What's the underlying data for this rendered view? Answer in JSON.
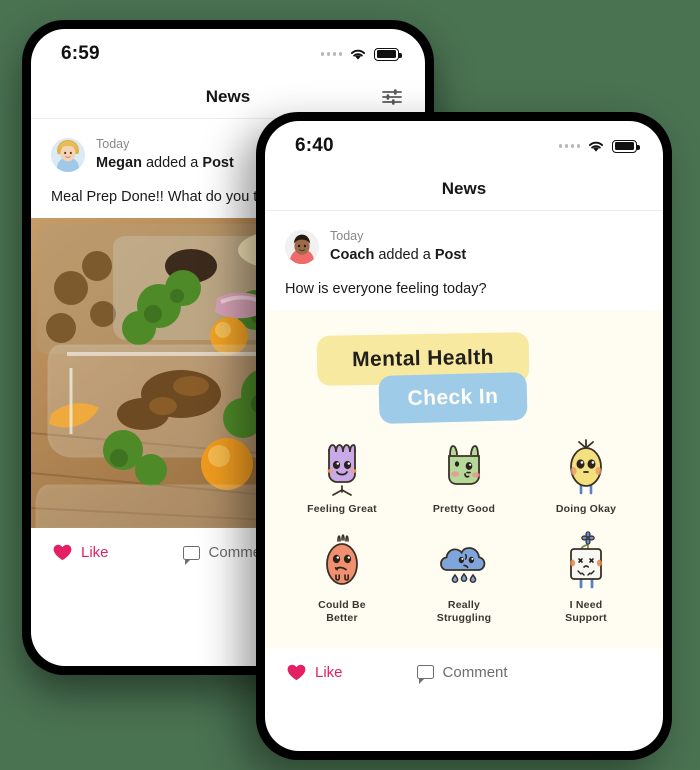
{
  "theme": {
    "page_background": "#4a7352",
    "accent_like": "#e51f63",
    "checkin_background": "#fffcf2",
    "banner_yellow": "#f8e9a1",
    "banner_blue": "#9ecbe8"
  },
  "phone_back": {
    "status": {
      "time": "6:59",
      "signal_icon": "signal-dots-icon",
      "wifi_icon": "wifi-icon",
      "battery_icon": "battery-full-icon"
    },
    "nav": {
      "title": "News",
      "filter_icon": "filter-sliders-icon"
    },
    "post": {
      "avatar_icon": "avatar-megan",
      "when": "Today",
      "author": "Megan",
      "action_middle": " added a ",
      "action_type": "Post",
      "body": "Meal Prep Done!! What do you thi",
      "image_icon": "meal-prep-photo"
    },
    "actions": {
      "like_label": "Like",
      "like_icon": "heart-icon",
      "comment_label": "Comment",
      "comment_icon": "comment-bubble-icon"
    }
  },
  "phone_front": {
    "status": {
      "time": "6:40",
      "signal_icon": "signal-dots-icon",
      "wifi_icon": "wifi-icon",
      "battery_icon": "battery-full-icon"
    },
    "nav": {
      "title": "News"
    },
    "post": {
      "avatar_icon": "avatar-coach",
      "when": "Today",
      "author": "Coach",
      "action_middle": " added a ",
      "action_type": "Post",
      "body": "How is everyone feeling today?"
    },
    "checkin": {
      "banner_top": "Mental Health",
      "banner_bottom": "Check In",
      "moods": [
        {
          "label": "Feeling Great",
          "icon": "mood-feeling-great-icon",
          "color": "#c9a9e8"
        },
        {
          "label": "Pretty Good",
          "icon": "mood-pretty-good-icon",
          "color": "#b6d99a"
        },
        {
          "label": "Doing Okay",
          "icon": "mood-doing-okay-icon",
          "color": "#f3e07e"
        },
        {
          "label": "Could Be Better",
          "icon": "mood-could-be-better-icon",
          "color": "#f09070"
        },
        {
          "label": "Really Struggling",
          "icon": "mood-really-struggling-icon",
          "color": "#7ea6dd"
        },
        {
          "label": "I Need Support",
          "icon": "mood-i-need-support-icon",
          "color": "#f7f7f4"
        }
      ]
    },
    "actions": {
      "like_label": "Like",
      "like_icon": "heart-icon",
      "comment_label": "Comment",
      "comment_icon": "comment-bubble-icon"
    }
  }
}
